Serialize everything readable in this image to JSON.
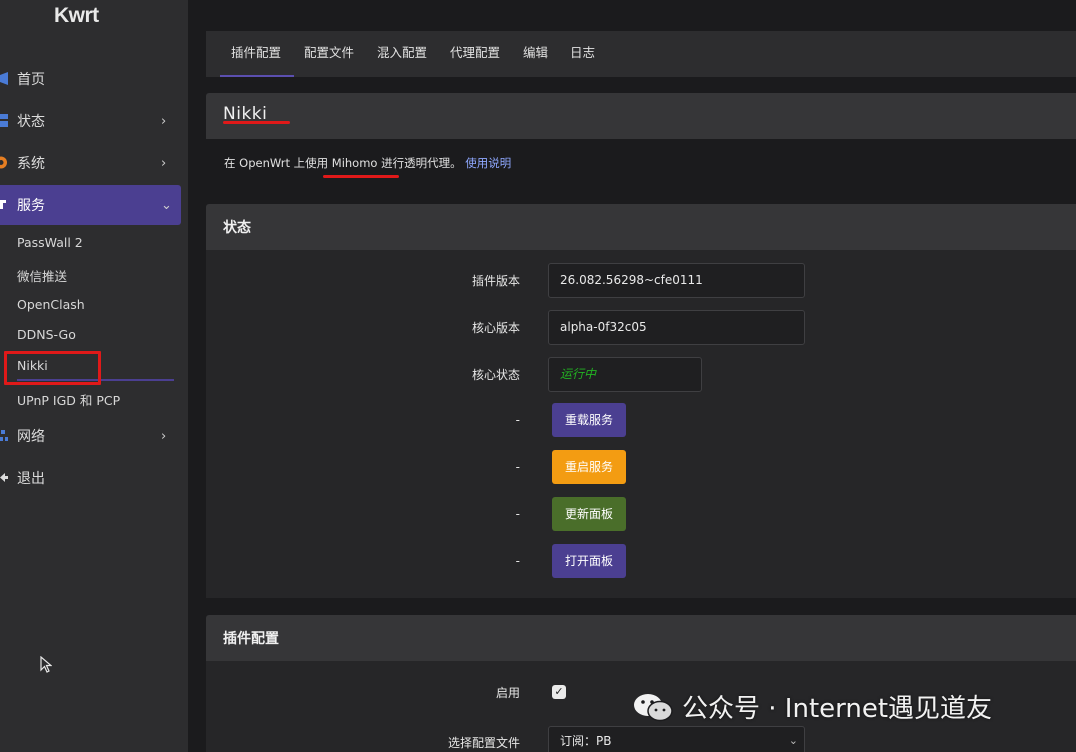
{
  "app": {
    "logo": "Kwrt"
  },
  "sidebar": {
    "items": [
      {
        "label": "首页",
        "icon": "home-icon",
        "color": "#4a7bd6"
      },
      {
        "label": "状态",
        "icon": "status-icon",
        "chevron": "›",
        "color": "#4a7bd6"
      },
      {
        "label": "系统",
        "icon": "gear-icon",
        "chevron": "›",
        "color": "#e67e22"
      },
      {
        "label": "服务",
        "icon": "services-icon",
        "chevron": "⌄",
        "color": "#ffffff"
      },
      {
        "label": "网络",
        "icon": "network-icon",
        "chevron": "›",
        "color": "#4a7bd6"
      },
      {
        "label": "退出",
        "icon": "logout-icon",
        "color": "#dcdcdc"
      }
    ],
    "sub_items": [
      "PassWall 2",
      "微信推送",
      "OpenClash",
      "DDNS-Go",
      "Nikki",
      "UPnP IGD 和 PCP"
    ]
  },
  "tabs": [
    "插件配置",
    "配置文件",
    "混入配置",
    "代理配置",
    "编辑",
    "日志"
  ],
  "header": {
    "title": "Nikki",
    "desc_prefix": "在 OpenWrt 上使用",
    "desc_mid": "Mihomo",
    "desc_suffix": "进行透明代理。",
    "desc_link": "使用说明"
  },
  "status": {
    "title": "状态",
    "plugin_version_label": "插件版本",
    "plugin_version": "26.082.56298~cfe0111",
    "core_version_label": "核心版本",
    "core_version": "alpha-0f32c05",
    "core_status_label": "核心状态",
    "core_status": "运行中",
    "dash": "-",
    "buttons": [
      {
        "label": "重载服务",
        "color": "#4b3f91"
      },
      {
        "label": "重启服务",
        "color": "#f39c12"
      },
      {
        "label": "更新面板",
        "color": "#4a6e2a"
      },
      {
        "label": "打开面板",
        "color": "#4b3f91"
      }
    ]
  },
  "plugin_config": {
    "title": "插件配置",
    "enable_label": "启用",
    "enable_checked": "✓",
    "profile_label": "选择配置文件",
    "profile_value": "订阅：PB"
  },
  "watermark": {
    "text": "公众号 · Internet遇见道友",
    "icon": "wechat-icon"
  }
}
